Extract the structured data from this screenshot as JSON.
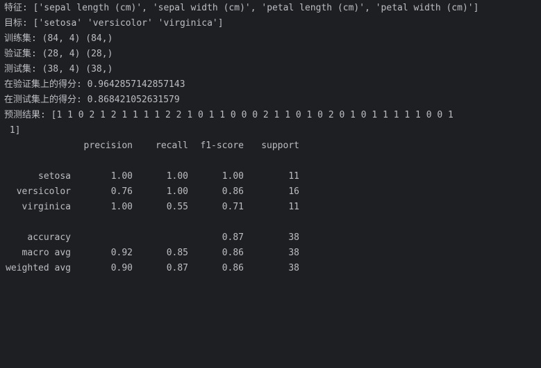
{
  "lines": {
    "features": "特征: ['sepal length (cm)', 'sepal width (cm)', 'petal length (cm)', 'petal width (cm)']",
    "targets": "目标: ['setosa' 'versicolor' 'virginica']",
    "train": "训练集: (84, 4) (84,)",
    "val": "验证集: (28, 4) (28,)",
    "test": "测试集: (38, 4) (38,)",
    "val_score": "在验证集上的得分: 0.9642857142857143",
    "test_score": "在测试集上的得分: 0.868421052631579",
    "pred1": "预测结果: [1 1 0 2 1 2 1 1 1 1 2 2 1 0 1 1 0 0 0 2 1 1 0 1 0 2 0 1 0 1 1 1 1 1 0 0 1",
    "pred2": " 1]"
  },
  "report": {
    "header": {
      "precision": "precision",
      "recall": "recall",
      "f1": "f1-score",
      "support": "support"
    },
    "rows": [
      {
        "label": "setosa",
        "precision": "1.00",
        "recall": "1.00",
        "f1": "1.00",
        "support": "11"
      },
      {
        "label": "versicolor",
        "precision": "0.76",
        "recall": "1.00",
        "f1": "0.86",
        "support": "16"
      },
      {
        "label": "virginica",
        "precision": "1.00",
        "recall": "0.55",
        "f1": "0.71",
        "support": "11"
      }
    ],
    "summary": [
      {
        "label": "accuracy",
        "precision": "",
        "recall": "",
        "f1": "0.87",
        "support": "38"
      },
      {
        "label": "macro avg",
        "precision": "0.92",
        "recall": "0.85",
        "f1": "0.86",
        "support": "38"
      },
      {
        "label": "weighted avg",
        "precision": "0.90",
        "recall": "0.87",
        "f1": "0.86",
        "support": "38"
      }
    ]
  }
}
